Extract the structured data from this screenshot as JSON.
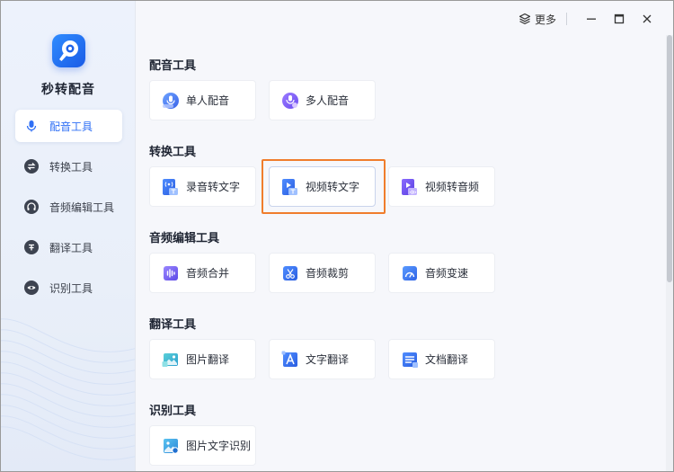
{
  "app": {
    "name": "秒转配音"
  },
  "sidebar": {
    "items": [
      {
        "label": "配音工具",
        "icon": "microphone-icon",
        "active": true
      },
      {
        "label": "转换工具",
        "icon": "convert-icon",
        "active": false
      },
      {
        "label": "音频编辑工具",
        "icon": "headphones-icon",
        "active": false
      },
      {
        "label": "翻译工具",
        "icon": "translate-icon",
        "active": false
      },
      {
        "label": "识别工具",
        "icon": "eye-icon",
        "active": false
      }
    ]
  },
  "titlebar": {
    "more_label": "更多",
    "more_icon": "layers-icon",
    "controls": [
      "minimize-icon",
      "maximize-icon",
      "close-icon"
    ]
  },
  "sections": [
    {
      "title": "配音工具",
      "cards": [
        {
          "label": "单人配音",
          "icon": "single-voice-icon"
        },
        {
          "label": "多人配音",
          "icon": "multi-voice-icon"
        }
      ]
    },
    {
      "title": "转换工具",
      "cards": [
        {
          "label": "录音转文字",
          "icon": "audio-to-text-icon"
        },
        {
          "label": "视频转文字",
          "icon": "video-to-text-icon",
          "highlighted": true
        },
        {
          "label": "视频转音频",
          "icon": "video-to-audio-icon"
        }
      ]
    },
    {
      "title": "音频编辑工具",
      "cards": [
        {
          "label": "音频合并",
          "icon": "audio-merge-icon"
        },
        {
          "label": "音频裁剪",
          "icon": "audio-cut-icon"
        },
        {
          "label": "音频变速",
          "icon": "audio-speed-icon"
        }
      ]
    },
    {
      "title": "翻译工具",
      "cards": [
        {
          "label": "图片翻译",
          "icon": "image-translate-icon"
        },
        {
          "label": "文字翻译",
          "icon": "text-translate-icon"
        },
        {
          "label": "文档翻译",
          "icon": "document-translate-icon"
        }
      ]
    },
    {
      "title": "识别工具",
      "cards": [
        {
          "label": "图片文字识别",
          "icon": "image-ocr-icon"
        }
      ]
    }
  ],
  "colors": {
    "accent": "#2f6ff5",
    "highlight": "#f07d2c",
    "sidebar_bg": "#edf2fc",
    "main_bg": "#f6f7fb"
  }
}
